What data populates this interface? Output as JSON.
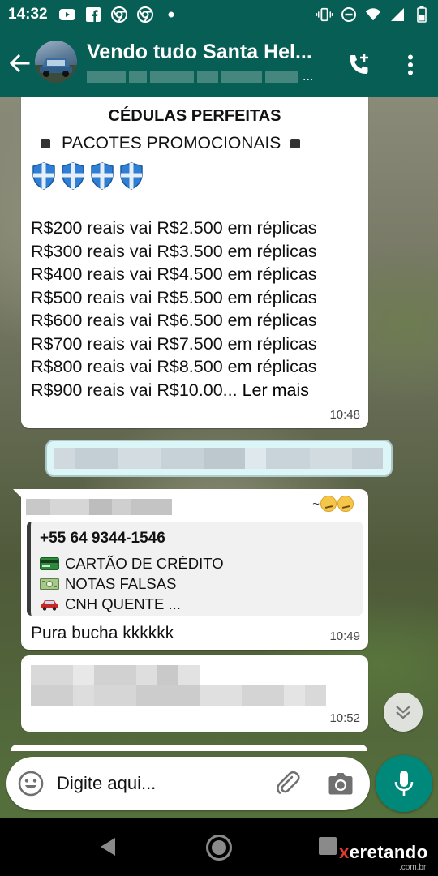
{
  "status_bar": {
    "time": "14:32",
    "left_icons": [
      "youtube-icon",
      "facebook-icon",
      "chrome-icon",
      "chrome-icon",
      "notification-dot-icon"
    ],
    "right_icons": [
      "vibrate-icon",
      "do-not-disturb-icon",
      "wifi-icon",
      "signal-icon",
      "battery-icon"
    ]
  },
  "header": {
    "title": "Vendo tudo  Santa Hel...",
    "subtitle_ellipsis": "...",
    "accent_color": "#075e54"
  },
  "messages": [
    {
      "type": "incoming",
      "heading": "CÉDULAS PERFEITAS",
      "subheading": "PACOTES PROMOCIONAIS",
      "prices": [
        "R$200 reais vai R$2.500 em réplicas",
        "R$300 reais vai R$3.500 em réplicas",
        "R$400 reais vai R$4.500 em réplicas",
        "R$500 reais vai R$5.500 em réplicas",
        "R$600 reais vai R$6.500 em réplicas",
        "R$700 reais vai R$7.500 em réplicas",
        "R$800 reais vai R$8.500 em réplicas"
      ],
      "last_line": "R$900 reais vai R$10.00...",
      "read_more": "Ler mais",
      "time": "10:48"
    },
    {
      "type": "incoming",
      "emoji_prefix": "~",
      "quote": {
        "phone": "+55 64 9344-1546",
        "lines": [
          "CARTÃO DE CRÉDITO",
          "NOTAS FALSAS",
          "CNH QUENTE ..."
        ]
      },
      "text": "Pura bucha kkkkkk",
      "time": "10:49"
    },
    {
      "type": "incoming",
      "time": "10:52"
    }
  ],
  "composer": {
    "placeholder": "Digite aqui..."
  },
  "watermark": {
    "brand_x": "x",
    "brand_rest": "eretando",
    "sub": ".com.br"
  }
}
